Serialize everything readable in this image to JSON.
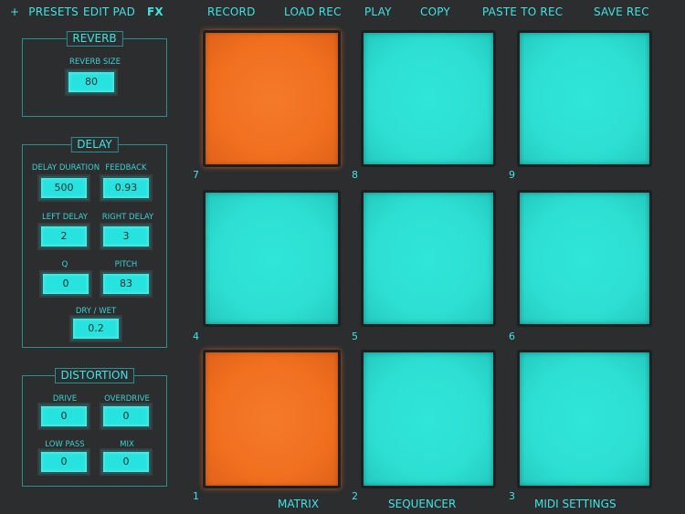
{
  "nav": {
    "presets": "PRESETS",
    "presets_icon": "+",
    "edit_pad": "EDIT PAD",
    "fx": "FX",
    "record": "RECORD",
    "load_rec": "LOAD REC",
    "play": "PLAY",
    "copy": "COPY",
    "paste_to_rec": "PASTE TO REC",
    "save_rec": "SAVE REC"
  },
  "reverb": {
    "title": "REVERB",
    "size_label": "REVERB SIZE",
    "size_value": "80"
  },
  "delay": {
    "title": "DELAY",
    "duration_label": "DELAY DURATION",
    "duration_value": "500",
    "feedback_label": "FEEDBACK",
    "feedback_value": "0.93",
    "left_label": "LEFT DELAY",
    "left_value": "2",
    "right_label": "RIGHT DELAY",
    "right_value": "3",
    "q_label": "Q",
    "q_value": "0",
    "pitch_label": "PITCH",
    "pitch_value": "83",
    "drywet_label": "DRY / WET",
    "drywet_value": "0.2"
  },
  "distortion": {
    "title": "DISTORTION",
    "drive_label": "DRIVE",
    "drive_value": "0",
    "overdrive_label": "OVERDRIVE",
    "overdrive_value": "0",
    "lowpass_label": "LOW PASS",
    "lowpass_value": "0",
    "mix_label": "MIX",
    "mix_value": "0"
  },
  "pads": [
    {
      "number": "7",
      "color": "#f0701f"
    },
    {
      "number": "8",
      "color": "#2ddfd2"
    },
    {
      "number": "9",
      "color": "#2ddfd2"
    },
    {
      "number": "4",
      "color": "#2ddfd2"
    },
    {
      "number": "5",
      "color": "#2ddfd2"
    },
    {
      "number": "6",
      "color": "#2ddfd2"
    },
    {
      "number": "1",
      "color": "#f0701f"
    },
    {
      "number": "2",
      "color": "#2ddfd2"
    },
    {
      "number": "3",
      "color": "#2ddfd2"
    }
  ],
  "footer": {
    "matrix": "MATRIX",
    "sequencer": "SEQUENCER",
    "midi_settings": "MIDI SETTINGS"
  },
  "colors": {
    "accent": "#42e3e3",
    "pad_active": "#f0701f",
    "pad_idle": "#2ddfd2",
    "background": "#2b2d2f"
  }
}
